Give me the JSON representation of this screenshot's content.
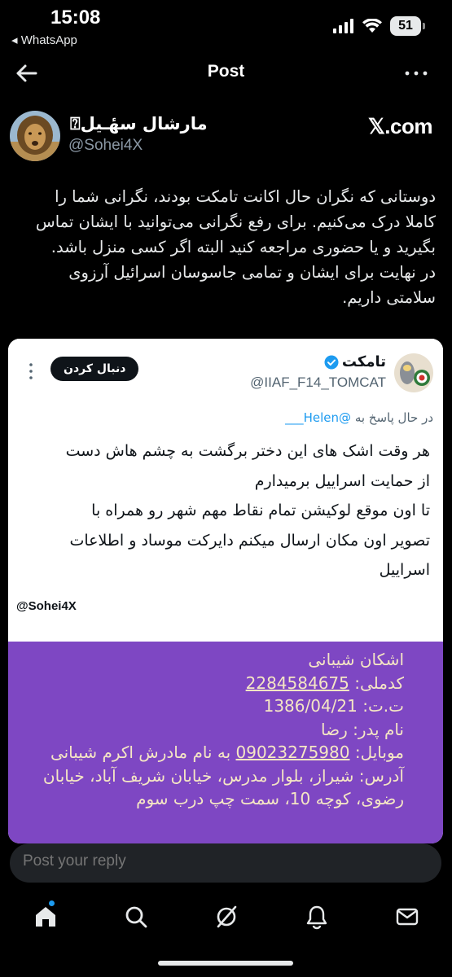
{
  "status_bar": {
    "time": "15:08",
    "back_app": "◂ WhatsApp",
    "battery": "51",
    "icons": [
      "signal-icon",
      "wifi-icon",
      "battery-icon"
    ]
  },
  "nav": {
    "title": "Post",
    "back_icon": "arrow-left-icon",
    "more_icon": "more-icon"
  },
  "author": {
    "name": "مارشال سهٔـیل⍰",
    "handle": "@Sohei4X",
    "source": "𝕏.com"
  },
  "post": {
    "lines": [
      "دوستانی که نگران حال اکانت تامکت بودند، نگرانی شما را",
      "کاملا درک می‌کنیم. برای رفع نگرانی می‌توانید با ایشان تماس",
      "بگیرید و یا حضوری مراجعه کنید البته اگر کسی منزل باشد.",
      "در نهایت برای ایشان و تمامی جاسوسان اسرائیل آرزوی",
      "سلامتی داریم."
    ]
  },
  "quoted": {
    "name": "تامکت",
    "handle": "@IIAF_F14_TOMCAT",
    "follow_label": "دنبال کردن",
    "reply_prefix": "در حال پاسخ به",
    "reply_mention": "@Helen___",
    "body_lines": [
      "هر وقت اشک های این دختر برگشت به چشم هاش دست",
      "از حمایت اسراییل برمیدارم",
      "تا اون موقع لوکیشن تمام نقاط مهم شهر رو همراه با",
      "تصویر اون مکان ارسال میکنم دایرکت موساد و اطلاعات",
      "اسراییل"
    ],
    "watermark": "@Sohei4X"
  },
  "doc": {
    "line1": "اشکان شیبانی",
    "code_label": "کدملی:",
    "code_value": "2284584675",
    "dob_label": "ت.ت:",
    "dob_value": "1386/04/21",
    "father": "نام پدر: رضا",
    "mobile_label": "موبایل:",
    "mobile_value": "09023275980",
    "mobile_suffix": "به نام مادرش اکرم شیبانی",
    "address_line1": "آدرس: شیراز، بلوار مدرس، خیابان شریف آباد، خیابان",
    "address_line2": "رضوی، کوچه 10، سمت چپ درب سوم"
  },
  "reply": {
    "placeholder": "Post your reply"
  },
  "bottom_nav": [
    "home-icon",
    "search-icon",
    "grok-icon",
    "notifications-icon",
    "messages-icon"
  ],
  "colors": {
    "background": "#000000",
    "accent": "#1d9bf0",
    "card_purple": "#7e47c3",
    "doc_text": "#f5e6c4"
  }
}
